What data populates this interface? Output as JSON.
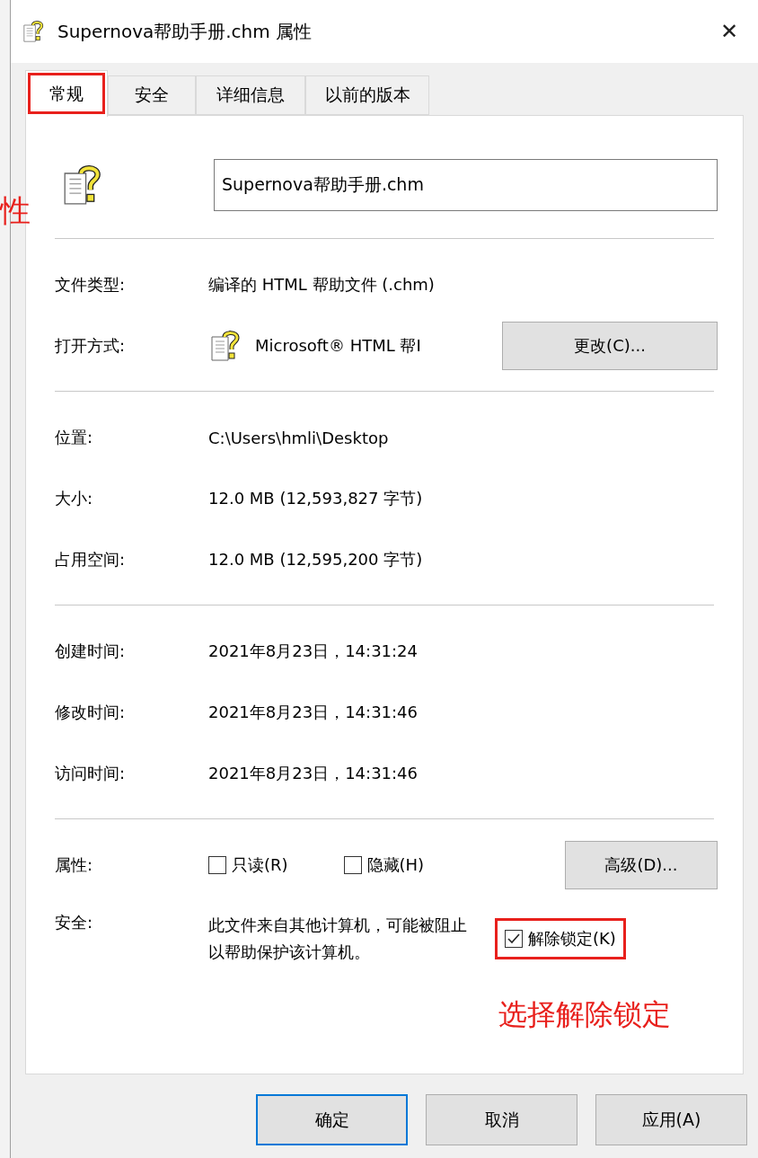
{
  "window": {
    "title": "Supernova帮助手册.chm 属性",
    "close": "✕"
  },
  "tabs": [
    {
      "label": "常规",
      "selected": true,
      "highlighted": true
    },
    {
      "label": "安全",
      "selected": false,
      "highlighted": false
    },
    {
      "label": "详细信息",
      "selected": false,
      "highlighted": false
    },
    {
      "label": "以前的版本",
      "selected": false,
      "highlighted": false
    }
  ],
  "file_name": {
    "value": "Supernova帮助手册.chm"
  },
  "sections": [
    [
      {
        "label": "文件类型:",
        "value": "编译的 HTML 帮助文件 (.chm)"
      },
      {
        "label": "打开方式:",
        "value": "Microsoft® HTML 帮I",
        "button": "更改(C)..."
      }
    ],
    [
      {
        "label": "位置:",
        "value": "C:\\Users\\hmli\\Desktop"
      },
      {
        "label": "大小:",
        "value": "12.0 MB (12,593,827 字节)"
      },
      {
        "label": "占用空间:",
        "value": "12.0 MB (12,595,200 字节)"
      }
    ],
    [
      {
        "label": "创建时间:",
        "value": "2021年8月23日，14:31:24"
      },
      {
        "label": "修改时间:",
        "value": "2021年8月23日，14:31:46"
      },
      {
        "label": "访问时间:",
        "value": "2021年8月23日，14:31:46"
      }
    ]
  ],
  "attributes": {
    "label": "属性:",
    "checkboxes": [
      {
        "label": "只读(R)",
        "checked": false
      },
      {
        "label": "隐藏(H)",
        "checked": false
      }
    ],
    "button": "高级(D)..."
  },
  "security": {
    "label": "安全:",
    "text": "此文件来自其他计算机，可能被阻止以帮助保护该计算机。",
    "unblock": {
      "label": "解除锁定(K)",
      "checked": true,
      "highlighted": true
    }
  },
  "buttons": [
    {
      "label": "确定",
      "default": true
    },
    {
      "label": "取消",
      "default": false
    },
    {
      "label": "应用(A)",
      "default": false
    }
  ],
  "annotations": [
    {
      "text": "性"
    },
    {
      "text": "选择解除锁定"
    }
  ]
}
